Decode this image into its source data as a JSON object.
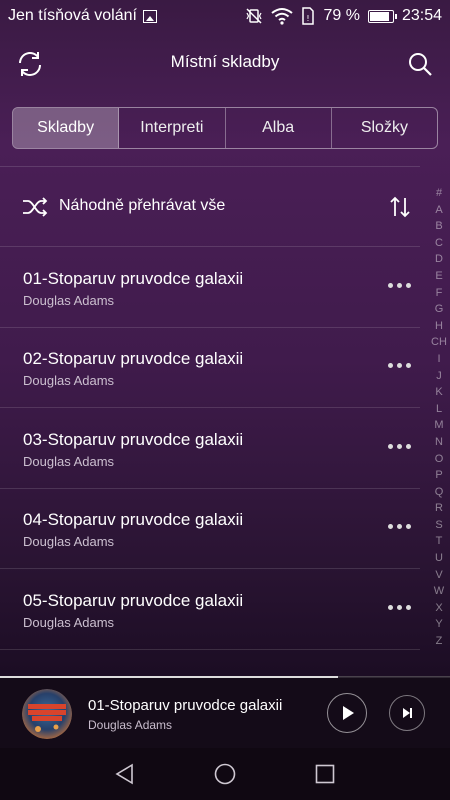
{
  "status_bar": {
    "carrier_text": "Jen tísňová volání",
    "battery_percent": "79 %",
    "time": "23:54",
    "icons": [
      "image-notification-icon",
      "vibrate-icon",
      "wifi-icon",
      "sim-icon",
      "battery-icon"
    ]
  },
  "header": {
    "title": "Místní skladby",
    "left_icon": "refresh-icon",
    "right_icon": "search-icon"
  },
  "tabs": [
    {
      "label": "Skladby",
      "active": true
    },
    {
      "label": "Interpreti",
      "active": false
    },
    {
      "label": "Alba",
      "active": false
    },
    {
      "label": "Složky",
      "active": false
    }
  ],
  "shuffle": {
    "label": "Náhodně přehrávat vše",
    "icon": "shuffle-icon",
    "sort_icon": "sort-icon"
  },
  "songs": [
    {
      "title": "01-Stoparuv pruvodce galaxii",
      "artist": "Douglas Adams"
    },
    {
      "title": "02-Stoparuv pruvodce galaxii",
      "artist": "Douglas Adams"
    },
    {
      "title": "03-Stoparuv pruvodce galaxii",
      "artist": "Douglas Adams"
    },
    {
      "title": "04-Stoparuv pruvodce galaxii",
      "artist": "Douglas Adams"
    },
    {
      "title": "05-Stoparuv pruvodce galaxii",
      "artist": "Douglas Adams"
    }
  ],
  "alpha_index": [
    "#",
    "A",
    "B",
    "C",
    "D",
    "E",
    "F",
    "G",
    "H",
    "CH",
    "I",
    "J",
    "K",
    "L",
    "M",
    "N",
    "O",
    "P",
    "Q",
    "R",
    "S",
    "T",
    "U",
    "V",
    "W",
    "X",
    "Y",
    "Z"
  ],
  "now_playing": {
    "title": "01-Stoparuv pruvodce galaxii",
    "artist": "Douglas Adams",
    "progress": 0.75,
    "cover_text": [
      "STOPARŮV",
      "PRŮVODCE",
      "GALAXIÍ"
    ]
  },
  "colors": {
    "accent": "#ffffff",
    "background_top": "#4a1f56",
    "background_bottom": "#140a1a"
  }
}
